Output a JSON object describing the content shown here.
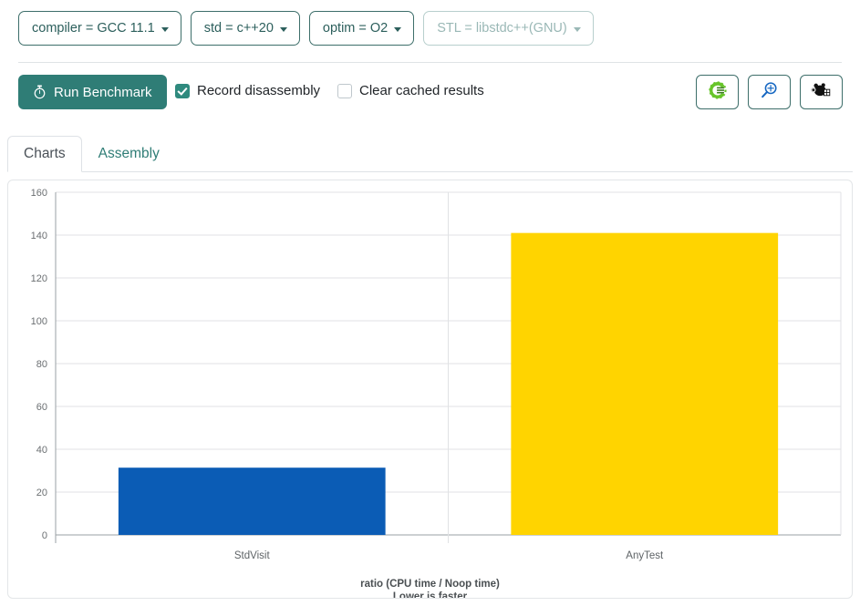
{
  "options": [
    {
      "label": "compiler = GCC 11.1",
      "name": "compiler-dropdown",
      "disabled": false
    },
    {
      "label": "std = c++20",
      "name": "std-dropdown",
      "disabled": false
    },
    {
      "label": "optim = O2",
      "name": "optim-dropdown",
      "disabled": false
    },
    {
      "label": "STL = libstdc++(GNU)",
      "name": "stl-dropdown",
      "disabled": true
    }
  ],
  "actions": {
    "run_label": "Run Benchmark",
    "record_disassembly_label": "Record disassembly",
    "record_disassembly_checked": true,
    "clear_cached_label": "Clear cached results",
    "clear_cached_checked": false,
    "icon_buttons": [
      {
        "name": "compiler-explorer-icon",
        "title": "Compiler Explorer"
      },
      {
        "name": "quick-bench-icon",
        "title": "Quick Bench"
      },
      {
        "name": "build-bench-icon",
        "title": "Build Bench"
      }
    ]
  },
  "tabs": [
    {
      "label": "Charts",
      "active": true
    },
    {
      "label": "Assembly",
      "active": false
    }
  ],
  "colors": {
    "teal": "#2f7d76",
    "bar_blue": "#0b5cb5",
    "bar_yellow": "#ffd400",
    "grid": "#e0e2e4",
    "axis": "#9aa0a4"
  },
  "chart_data": {
    "type": "bar",
    "title": "",
    "categories": [
      "StdVisit",
      "AnyTest"
    ],
    "values": [
      31.4,
      141.0
    ],
    "colors": [
      "#0b5cb5",
      "#ffd400"
    ],
    "xlabel": "",
    "ylabel": "",
    "ylim": [
      0,
      160
    ],
    "yticks": [
      0,
      20,
      40,
      60,
      80,
      100,
      120,
      140,
      160
    ],
    "grid": true,
    "legend": "none",
    "caption_line1": "ratio (CPU time / Noop time)",
    "caption_line2": "Lower is faster"
  }
}
